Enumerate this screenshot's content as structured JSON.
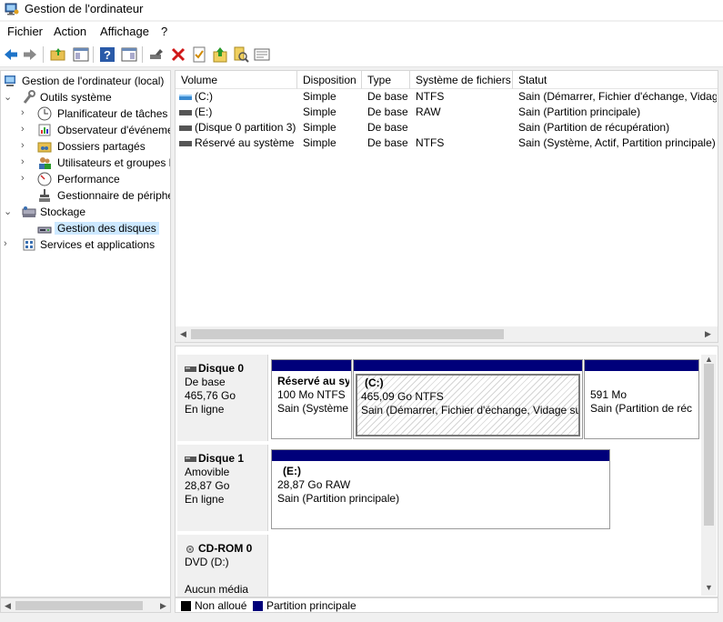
{
  "window": {
    "title": "Gestion de l'ordinateur"
  },
  "menu": [
    "Fichier",
    "Action",
    "Affichage",
    "?"
  ],
  "toolbar": {
    "icons": [
      "back-arrow-icon",
      "forward-arrow-icon",
      "up-folder-icon",
      "show-hide-tree-icon",
      "help-icon",
      "show-hide-action-pane-icon",
      "connect-icon",
      "delete-icon",
      "properties-icon",
      "export-icon",
      "search-icon",
      "list-icon"
    ],
    "colors": {
      "back": "#1e73c8",
      "delete": "#d01818"
    }
  },
  "tree": {
    "root": "Gestion de l'ordinateur (local)",
    "system_tools": "Outils système",
    "task_scheduler": "Planificateur de tâches",
    "event_viewer": "Observateur d'événeme",
    "shared_folders": "Dossiers partagés",
    "local_users": "Utilisateurs et groupes l",
    "performance": "Performance",
    "device_manager": "Gestionnaire de périphé",
    "storage": "Stockage",
    "disk_management": "Gestion des disques",
    "services": "Services et applications"
  },
  "volumes": {
    "headers": [
      "Volume",
      "Disposition",
      "Type",
      "Système de fichiers",
      "Statut"
    ],
    "rows": [
      {
        "volume": "(C:)",
        "layout": "Simple",
        "type": "De base",
        "fs": "NTFS",
        "status": "Sain (Démarrer, Fichier d'échange, Vidage"
      },
      {
        "volume": "(E:)",
        "layout": "Simple",
        "type": "De base",
        "fs": "RAW",
        "status": "Sain (Partition principale)"
      },
      {
        "volume": "(Disque 0 partition 3)",
        "layout": "Simple",
        "type": "De base",
        "fs": "",
        "status": "Sain (Partition de récupération)"
      },
      {
        "volume": "Réservé au système",
        "layout": "Simple",
        "type": "De base",
        "fs": "NTFS",
        "status": "Sain (Système, Actif, Partition principale)"
      }
    ]
  },
  "disks": {
    "disk0": {
      "name": "Disque 0",
      "type": "De base",
      "size": "465,76 Go",
      "state": "En ligne",
      "partitions": [
        {
          "title": "Réservé au sy",
          "size": "100 Mo NTFS",
          "status": "Sain (Système,"
        },
        {
          "title": "(C:)",
          "size": "465,09 Go NTFS",
          "status": "Sain (Démarrer, Fichier d'échange, Vidage sur"
        },
        {
          "title": "",
          "size": "591 Mo",
          "status": "Sain (Partition de réc"
        }
      ]
    },
    "disk1": {
      "name": "Disque 1",
      "type": "Amovible",
      "size": "28,87 Go",
      "state": "En ligne",
      "partitions": [
        {
          "title": "(E:)",
          "size": "28,87 Go RAW",
          "status": "Sain (Partition principale)"
        }
      ]
    },
    "cdrom0": {
      "name": "CD-ROM 0",
      "type": "DVD (D:)",
      "media": "Aucun média"
    }
  },
  "legend": {
    "unallocated": "Non alloué",
    "primary": "Partition principale",
    "colors": {
      "unallocated": "#000000",
      "primary": "#00007a"
    }
  }
}
